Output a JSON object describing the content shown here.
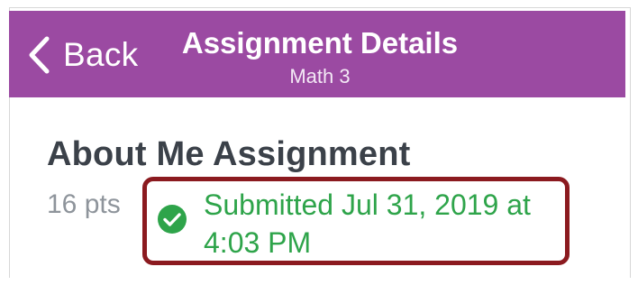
{
  "navbar": {
    "back_label": "Back",
    "title": "Assignment Details",
    "subtitle": "Math 3",
    "background_color": "#9b4aa2"
  },
  "assignment": {
    "name": "About Me Assignment",
    "points": "16 pts",
    "status": {
      "icon": "check-circle-icon",
      "line1": "Submitted Jul 31, 2019 at",
      "line2": "4:03 PM",
      "color": "#2ea44a"
    }
  }
}
